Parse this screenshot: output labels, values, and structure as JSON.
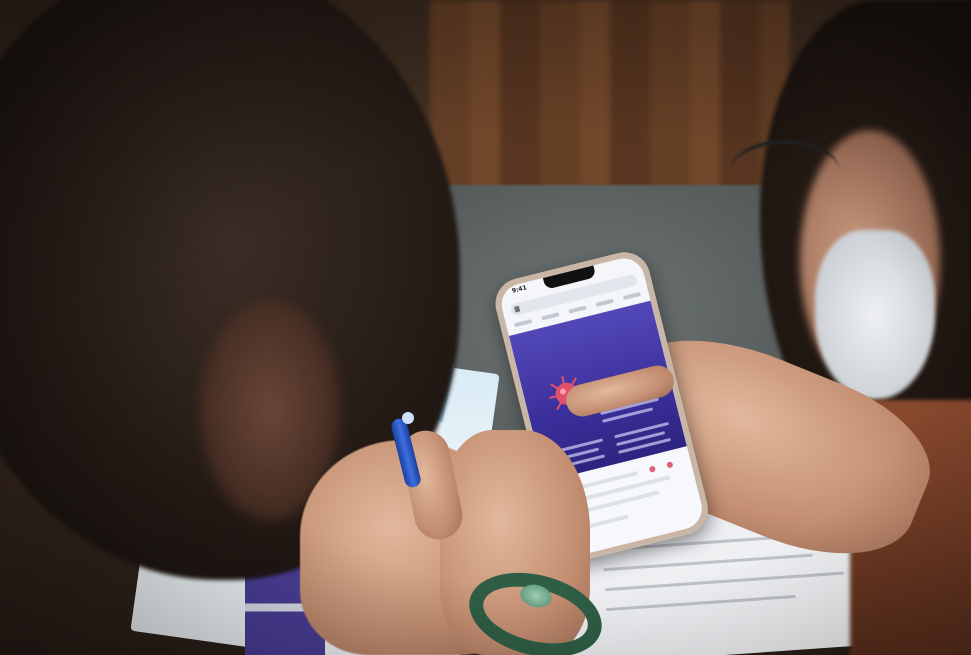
{
  "phone": {
    "status_time": "9:41",
    "url": "",
    "banner_title": "",
    "banner_subtitle": ""
  },
  "colors": {
    "banner": "#3a2f9a",
    "banner_title": "#ffe28a",
    "virus": "#e0506a",
    "pen": "#1c3f9e",
    "bracelet": "#2f5e45",
    "leaflet_stripe": "#7cc2e6"
  },
  "icons": [
    "virus-icon",
    "lock-icon"
  ]
}
